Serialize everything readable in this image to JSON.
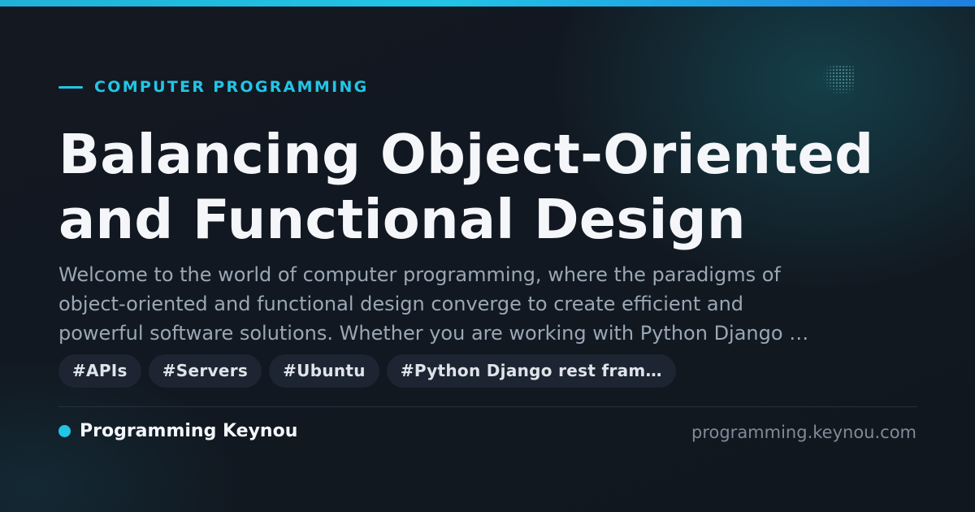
{
  "category": "COMPUTER PROGRAMMING",
  "title_lines": [
    "Balancing Object-Oriented",
    "and Functional Design"
  ],
  "description_lines": [
    "Welcome to the world of computer programming, where the paradigms of",
    "object-oriented and functional design converge to create efficient and",
    "powerful software solutions. Whether you are working with Python Django …"
  ],
  "tags": [
    "#APIs",
    "#Servers",
    "#Ubuntu",
    "#Python Django rest fram…"
  ],
  "brand": {
    "name": "Programming Keynou",
    "domain": "programming.keynou.com"
  },
  "colors": {
    "accent": "#22c5e6",
    "background": "#131922",
    "tag_bg": "#1c2531"
  }
}
